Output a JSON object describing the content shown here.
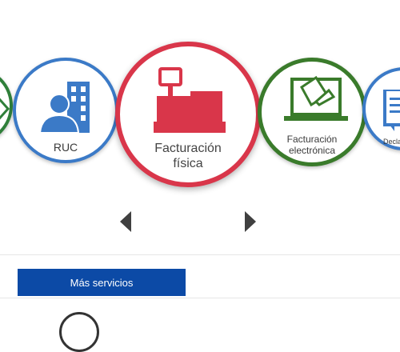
{
  "carousel": {
    "items": [
      {
        "id": "left-partial",
        "label": ""
      },
      {
        "id": "ruc",
        "label": "RUC",
        "icon": "person-building-icon",
        "color": "#3b7ac7"
      },
      {
        "id": "facturacion-fisica",
        "label_line1": "Facturación",
        "label_line2": "física",
        "icon": "cash-register-icon",
        "color": "#d9364a"
      },
      {
        "id": "facturacion-electronica",
        "label_line1": "Facturación",
        "label_line2": "electrónica",
        "icon": "laptop-document-icon",
        "color": "#3a7b2b"
      },
      {
        "id": "declaraciones",
        "label": "Decla",
        "icon": "document-icon",
        "color": "#3b7ac7"
      }
    ],
    "prev_icon": "chevron-left-icon",
    "next_icon": "chevron-right-icon"
  },
  "actions": {
    "more_services": "Más servicios"
  },
  "colors": {
    "primary_button": "#0c4aa6"
  }
}
